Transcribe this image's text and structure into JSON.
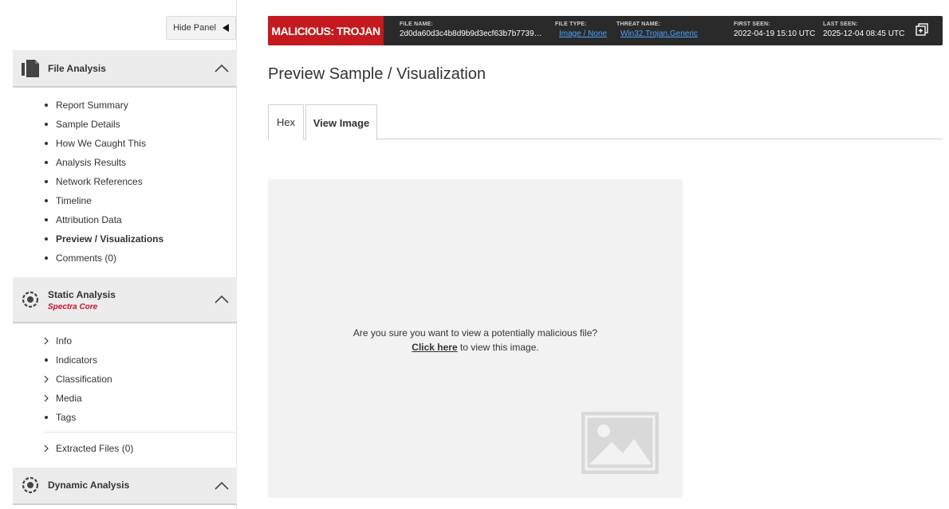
{
  "sidebar": {
    "hide_panel_label": "Hide Panel",
    "file_analysis": {
      "title": "File Analysis",
      "items": [
        {
          "label": "Report Summary"
        },
        {
          "label": "Sample Details"
        },
        {
          "label": "How We Caught This"
        },
        {
          "label": "Analysis Results"
        },
        {
          "label": "Network References"
        },
        {
          "label": "Timeline"
        },
        {
          "label": "Attribution Data"
        },
        {
          "label": "Preview / Visualizations",
          "active": true
        },
        {
          "label": "Comments (0)"
        }
      ]
    },
    "static_analysis": {
      "title": "Static Analysis",
      "subtitle": "Spectra Core",
      "items": [
        {
          "label": "Info",
          "type": "chevron"
        },
        {
          "label": "Indicators",
          "type": "bullet"
        },
        {
          "label": "Classification",
          "type": "chevron"
        },
        {
          "label": "Media",
          "type": "chevron"
        },
        {
          "label": "Tags",
          "type": "bullet"
        }
      ],
      "extracted": "Extracted Files (0)"
    },
    "dynamic_analysis": {
      "title": "Dynamic Analysis"
    }
  },
  "banner": {
    "verdict": "MALICIOUS: TROJAN",
    "file_name_label": "FILE NAME:",
    "file_name": "2d0da60d3c4b8d9b9d3ecf63b7b7739…",
    "file_type_label": "FILE TYPE:",
    "file_type": "Image / None",
    "threat_name_label": "THREAT NAME:",
    "threat_name": "Win32.Trojan.Generic",
    "first_seen_label": "FIRST SEEN:",
    "first_seen": "2022-04-19 15:10 UTC",
    "last_seen_label": "LAST SEEN:",
    "last_seen": "2025-12-04 08:45 UTC"
  },
  "main": {
    "page_title": "Preview Sample / Visualization",
    "tabs": [
      {
        "label": "Hex"
      },
      {
        "label": "View Image",
        "active": true
      }
    ],
    "preview": {
      "warning": "Are you sure you want to view a potentially malicious file?",
      "click_here": "Click here",
      "click_suffix": " to view this image."
    }
  },
  "colors": {
    "verdict_bg": "#c41a1f",
    "banner_bg": "#2a2a2a",
    "link": "#4da3ff",
    "subtitle_red": "#c8102e"
  }
}
